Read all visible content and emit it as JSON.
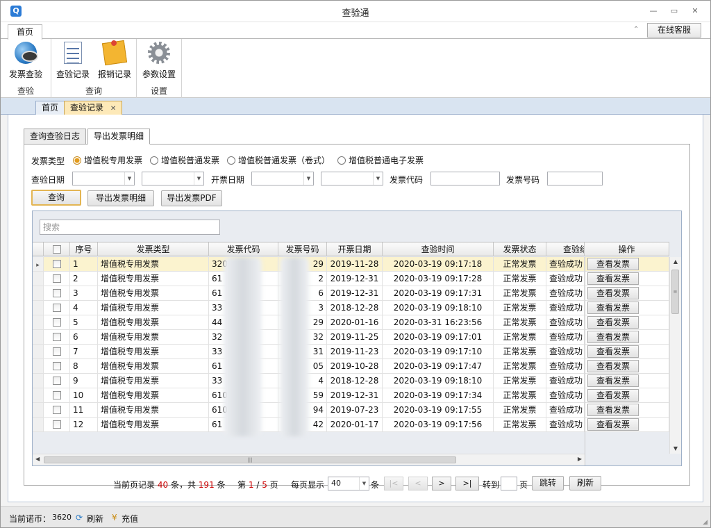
{
  "window": {
    "title": "查验通",
    "app_icon": "Q",
    "minimize": "—",
    "restore": "▭",
    "close": "✕"
  },
  "ribbon_tabs": [
    {
      "label": "首页"
    }
  ],
  "online_service": "在线客服",
  "ribbon_groups": [
    {
      "label": "查验",
      "buttons": [
        {
          "label": "发票查验",
          "icon": "globe-eye-icon"
        }
      ]
    },
    {
      "label": "查询",
      "buttons": [
        {
          "label": "查验记录",
          "icon": "document-icon"
        },
        {
          "label": "报销记录",
          "icon": "note-icon"
        }
      ]
    },
    {
      "label": "设置",
      "buttons": [
        {
          "label": "参数设置",
          "icon": "gear-icon"
        }
      ]
    }
  ],
  "doc_tabs": [
    {
      "label": "首页"
    },
    {
      "label": "查验记录"
    }
  ],
  "doc_tab_close": "✕",
  "sub_tabs": [
    {
      "label": "查询查验日志"
    },
    {
      "label": "导出发票明细"
    }
  ],
  "filters": {
    "invoice_type_label": "发票类型",
    "invoice_types": [
      "增值税专用发票",
      "增值税普通发票",
      "增值税普通发票（卷式）",
      "增值税普通电子发票"
    ],
    "selected_type": "增值税专用发票",
    "check_date_label": "查验日期",
    "issue_date_label": "开票日期",
    "invoice_code_label": "发票代码",
    "invoice_no_label": "发票号码"
  },
  "buttons": {
    "query": "查询",
    "export_detail": "导出发票明细",
    "export_pdf": "导出发票PDF"
  },
  "search": {
    "placeholder": "搜索"
  },
  "table": {
    "columns": [
      "序号",
      "发票类型",
      "发票代码",
      "发票号码",
      "开票日期",
      "查验时间",
      "发票状态",
      "查验结果",
      "操作"
    ],
    "rows": [
      {
        "no": "1",
        "type": "增值税专用发票",
        "code": "320",
        "code_tail": "0",
        "num_tail": "29",
        "date": "2019-11-28",
        "checked": "2020-03-19 09:17:18",
        "status": "正常发票",
        "result": "查验成功",
        "action": "查看发票"
      },
      {
        "no": "2",
        "type": "增值税专用发票",
        "code": "61",
        "code_tail": "",
        "num_tail": "2",
        "date": "2019-12-31",
        "checked": "2020-03-19 09:17:28",
        "status": "正常发票",
        "result": "查验成功",
        "action": "查看发票"
      },
      {
        "no": "3",
        "type": "增值税专用发票",
        "code": "61",
        "code_tail": "",
        "num_tail": "6",
        "date": "2019-12-31",
        "checked": "2020-03-19 09:17:31",
        "status": "正常发票",
        "result": "查验成功",
        "action": "查看发票"
      },
      {
        "no": "4",
        "type": "增值税专用发票",
        "code": "33",
        "code_tail": "",
        "num_tail": "3",
        "date": "2018-12-28",
        "checked": "2020-03-19 09:18:10",
        "status": "正常发票",
        "result": "查验成功",
        "action": "查看发票"
      },
      {
        "no": "5",
        "type": "增值税专用发票",
        "code": "44",
        "code_tail": "",
        "num_tail": "29",
        "date": "2020-01-16",
        "checked": "2020-03-31 16:23:56",
        "status": "正常发票",
        "result": "查验成功",
        "action": "查看发票"
      },
      {
        "no": "6",
        "type": "增值税专用发票",
        "code": "32",
        "code_tail": "",
        "num_tail": "32",
        "date": "2019-11-25",
        "checked": "2020-03-19 09:17:01",
        "status": "正常发票",
        "result": "查验成功",
        "action": "查看发票"
      },
      {
        "no": "7",
        "type": "增值税专用发票",
        "code": "33",
        "code_tail": "",
        "num_tail": "31",
        "date": "2019-11-23",
        "checked": "2020-03-19 09:17:10",
        "status": "正常发票",
        "result": "查验成功",
        "action": "查看发票"
      },
      {
        "no": "8",
        "type": "增值税专用发票",
        "code": "61",
        "code_tail": "",
        "num_tail": "05",
        "date": "2019-10-28",
        "checked": "2020-03-19 09:17:47",
        "status": "正常发票",
        "result": "查验成功",
        "action": "查看发票"
      },
      {
        "no": "9",
        "type": "增值税专用发票",
        "code": "33",
        "code_tail": "",
        "num_tail": "4",
        "date": "2018-12-28",
        "checked": "2020-03-19 09:18:10",
        "status": "正常发票",
        "result": "查验成功",
        "action": "查看发票"
      },
      {
        "no": "10",
        "type": "增值税专用发票",
        "code": "610",
        "code_tail": "",
        "num_tail": "59",
        "date": "2019-12-31",
        "checked": "2020-03-19 09:17:34",
        "status": "正常发票",
        "result": "查验成功",
        "action": "查看发票"
      },
      {
        "no": "11",
        "type": "增值税专用发票",
        "code": "610",
        "code_tail": "",
        "num_tail": "94",
        "date": "2019-07-23",
        "checked": "2020-03-19 09:17:55",
        "status": "正常发票",
        "result": "查验成功",
        "action": "查看发票"
      },
      {
        "no": "12",
        "type": "增值税专用发票",
        "code": "61",
        "code_tail": "",
        "num_tail": "42",
        "date": "2020-01-17",
        "checked": "2020-03-19 09:17:56",
        "status": "正常发票",
        "result": "查验成功",
        "action": "查看发票"
      }
    ],
    "scroll_grip": "|||",
    "scroll_up": "▲",
    "scroll_down": "▼",
    "scroll_left": "◀",
    "scroll_right": "▶",
    "row_pointer": "▸"
  },
  "pager": {
    "text_before_records": "当前页记录",
    "page_records": "40",
    "text_mid": "条，共",
    "total_records": "191",
    "text_unit": "条",
    "page_prefix": "第",
    "current_page": "1",
    "page_sep": "/",
    "total_pages": "5",
    "page_unit": "页",
    "per_page_label": "每页显示",
    "per_page": "40",
    "per_page_unit": "条",
    "first": "|<",
    "prev": "<",
    "next": ">",
    "last": ">|",
    "goto_label": "转到",
    "goto_unit": "页",
    "jump": "跳转",
    "refresh": "刷新"
  },
  "status": {
    "coin_label": "当前诺币：",
    "coin_value": "3620",
    "refresh": "刷新",
    "recharge": "充值"
  },
  "colors": {
    "selected_row": "#fbf3cf",
    "active_tab": "#fde9b8",
    "accent_red": "#cc0000",
    "radio_on": "#e39b1c"
  }
}
